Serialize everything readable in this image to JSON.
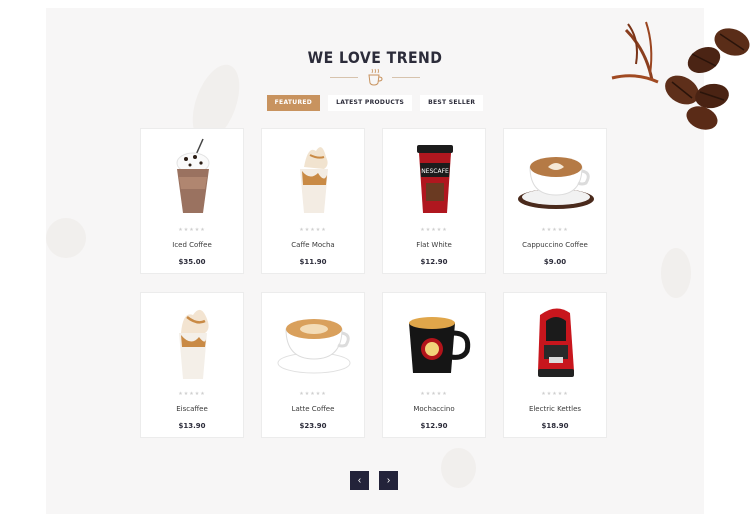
{
  "section": {
    "heading": "WE LOVE TREND"
  },
  "tabs": [
    {
      "label": "FEATURED",
      "active": true
    },
    {
      "label": "LATEST PRODUCTS",
      "active": false
    },
    {
      "label": "BEST SELLER",
      "active": false
    }
  ],
  "products": [
    {
      "name": "Iced Coffee",
      "price": "$35.00",
      "rating": "★★★★★",
      "icon": "iced-coffee-icon"
    },
    {
      "name": "Caffe Mocha",
      "price": "$11.90",
      "rating": "★★★★★",
      "icon": "caffe-mocha-icon"
    },
    {
      "name": "Flat White",
      "price": "$12.90",
      "rating": "★★★★★",
      "icon": "nescafe-cup-icon"
    },
    {
      "name": "Cappuccino Coffee",
      "price": "$9.00",
      "rating": "★★★★★",
      "icon": "cappuccino-cup-icon"
    },
    {
      "name": "Eiscaffee",
      "price": "$13.90",
      "rating": "★★★★★",
      "icon": "eiscaffee-icon"
    },
    {
      "name": "Latte Coffee",
      "price": "$23.90",
      "rating": "★★★★★",
      "icon": "latte-cup-icon"
    },
    {
      "name": "Mochaccino",
      "price": "$12.90",
      "rating": "★★★★★",
      "icon": "mochaccino-mug-icon"
    },
    {
      "name": "Electric Kettles",
      "price": "$18.90",
      "rating": "★★★★★",
      "icon": "coffee-machine-icon"
    }
  ],
  "pagination": {
    "prev": "‹",
    "next": "›"
  },
  "colors": {
    "accent": "#c8935f",
    "dark": "#23233a",
    "section_bg": "#f7f6f6"
  }
}
